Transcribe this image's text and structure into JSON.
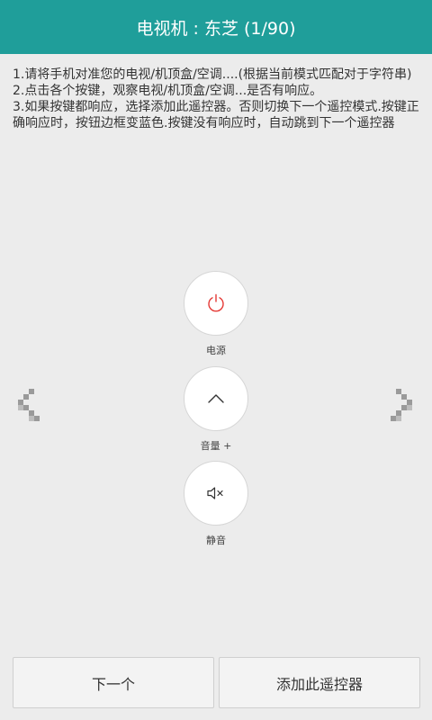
{
  "header": {
    "title": "电视机 : 东芝 (1/90)"
  },
  "instructions": {
    "line1": "1.请将手机对准您的电视/机顶盒/空调....(根据当前模式匹配对于字符串)",
    "line2": "2.点击各个按键，观察电视/机顶盒/空调...是否有响应。",
    "line3": "3.如果按键都响应，选择添加此遥控器。否则切换下一个遥控模式.按键正确响应时，按钮边框变蓝色.按键没有响应时，自动跳到下一个遥控器"
  },
  "remote": {
    "power_label": "电源",
    "volume_up_label": "音量 +",
    "mute_label": "静音",
    "power_icon_color": "#e53935"
  },
  "nav": {
    "prev_icon": "chevron-left-icon",
    "next_icon": "chevron-right-icon"
  },
  "footer": {
    "next_label": "下一个",
    "add_label": "添加此遥控器"
  },
  "colors": {
    "header_bg": "#1f9e9a",
    "page_bg": "#ececec"
  }
}
